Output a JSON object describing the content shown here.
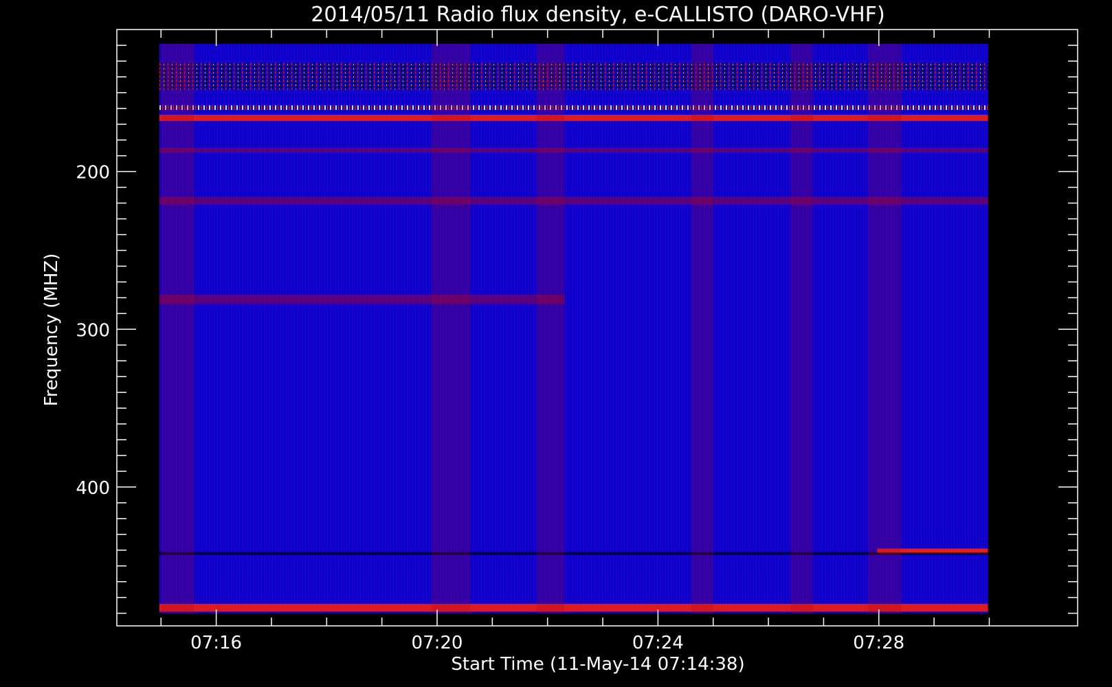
{
  "chart_data": {
    "type": "heatmap",
    "title": "2014/05/11  Radio flux density, e-CALLISTO (DARO-VHF)",
    "xlabel": "Start Time (11-May-14 07:14:38)",
    "ylabel": "Frequency (MHZ)",
    "x_ticks": [
      {
        "label": "07:16",
        "minutes": 16
      },
      {
        "label": "07:20",
        "minutes": 20
      },
      {
        "label": "07:24",
        "minutes": 24
      },
      {
        "label": "07:28",
        "minutes": 28
      }
    ],
    "y_ticks": [
      {
        "label": "200",
        "value": 200
      },
      {
        "label": "300",
        "value": 300
      },
      {
        "label": "400",
        "value": 400
      }
    ],
    "xlim_minutes": [
      14.2,
      31.6
    ],
    "ylim": [
      110,
      488
    ],
    "data_extent": {
      "x_minutes": [
        14.97,
        29.97
      ],
      "y_mhz": [
        119,
        480
      ]
    },
    "colors": {
      "background": "#0000f0",
      "weak": "#b00020",
      "strong": "#ff2000",
      "hot": "#ffff80",
      "low": "#000030"
    },
    "emission_bands": [
      {
        "mhz_start": 131,
        "mhz_end": 148,
        "kind": "speckle-dark-bright"
      },
      {
        "mhz_start": 158,
        "mhz_end": 161,
        "kind": "hot"
      },
      {
        "mhz_start": 164,
        "mhz_end": 168,
        "kind": "strong"
      },
      {
        "mhz_start": 185,
        "mhz_end": 188,
        "kind": "weak"
      },
      {
        "mhz_start": 216,
        "mhz_end": 221,
        "kind": "weak"
      },
      {
        "mhz_start": 278,
        "mhz_end": 284,
        "kind": "weak-partial"
      },
      {
        "mhz_start": 441,
        "mhz_end": 443,
        "kind": "mixed-line"
      },
      {
        "mhz_start": 474,
        "mhz_end": 479,
        "kind": "speckle-strong"
      }
    ]
  }
}
